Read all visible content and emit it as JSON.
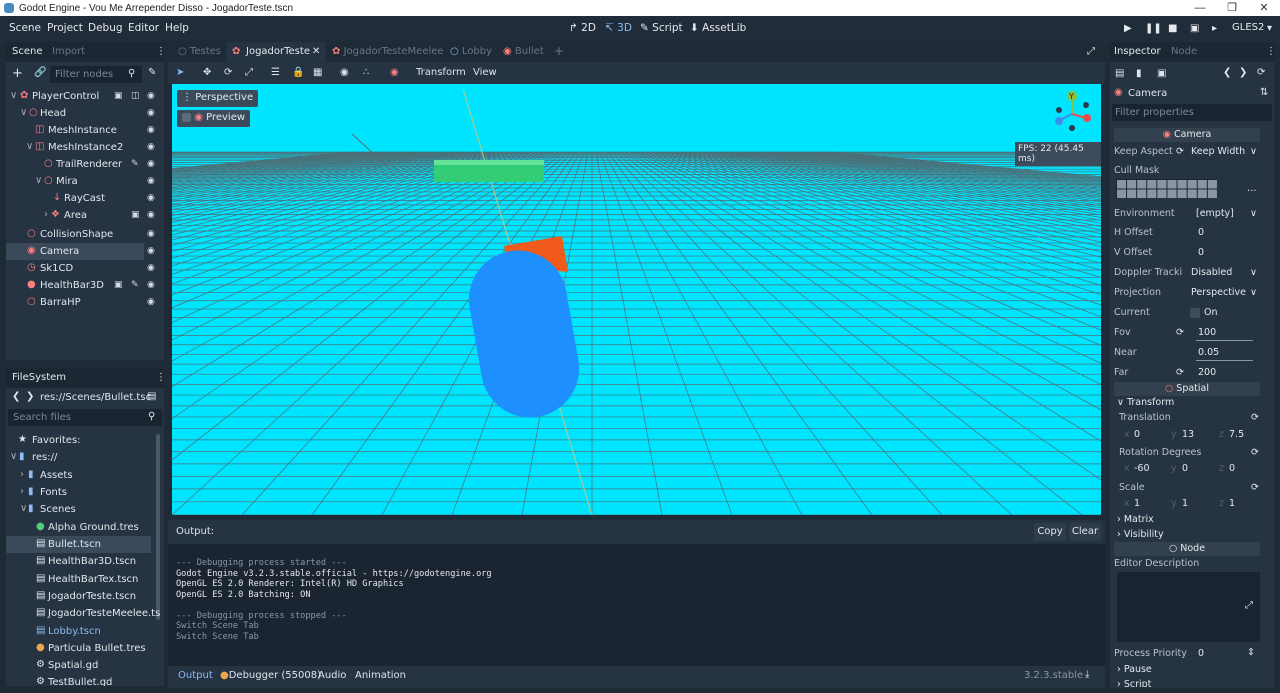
{
  "window": {
    "title": "Godot Engine - Vou Me Arrepender Disso - JogadorTeste.tscn"
  },
  "menu": [
    "Scene",
    "Project",
    "Debug",
    "Editor",
    "Help"
  ],
  "workspaces": [
    "2D",
    "3D",
    "Script",
    "AssetLib"
  ],
  "renderer": "GLES2",
  "scene_dock": {
    "tabs": [
      "Scene",
      "Import"
    ],
    "filter_placeholder": "Filter nodes",
    "nodes": [
      {
        "label": "PlayerControl",
        "icon": "kinematic-body-icon"
      },
      {
        "label": "Head",
        "icon": "spatial-icon"
      },
      {
        "label": "MeshInstance",
        "icon": "mesh-instance-icon"
      },
      {
        "label": "MeshInstance2",
        "icon": "mesh-instance-icon"
      },
      {
        "label": "TrailRenderer",
        "icon": "spatial-icon"
      },
      {
        "label": "Mira",
        "icon": "spatial-icon"
      },
      {
        "label": "RayCast",
        "icon": "raycast-icon"
      },
      {
        "label": "Area",
        "icon": "area-icon"
      },
      {
        "label": "CollisionShape",
        "icon": "spatial-icon"
      },
      {
        "label": "Camera",
        "icon": "camera-icon"
      },
      {
        "label": "Sk1CD",
        "icon": "timer-icon"
      },
      {
        "label": "HealthBar3D",
        "icon": "scene-instance-icon"
      },
      {
        "label": "BarraHP",
        "icon": "spatial-icon"
      }
    ]
  },
  "filesystem": {
    "title": "FileSystem",
    "path": "res://Scenes/Bullet.tsc",
    "search_placeholder": "Search files",
    "items": [
      {
        "label": "Favorites:",
        "icon": "star-icon"
      },
      {
        "label": "res://",
        "icon": "folder-icon"
      },
      {
        "label": "Assets",
        "icon": "folder-icon"
      },
      {
        "label": "Fonts",
        "icon": "folder-icon"
      },
      {
        "label": "Scenes",
        "icon": "folder-icon"
      },
      {
        "label": "Alpha Ground.tres",
        "icon": "resource-icon"
      },
      {
        "label": "Bullet.tscn",
        "icon": "scene-file-icon"
      },
      {
        "label": "HealthBar3D.tscn",
        "icon": "scene-file-icon"
      },
      {
        "label": "HealthBarTex.tscn",
        "icon": "scene-file-icon"
      },
      {
        "label": "JogadorTeste.tscn",
        "icon": "scene-file-icon"
      },
      {
        "label": "JogadorTesteMeelee.ts",
        "icon": "scene-file-icon"
      },
      {
        "label": "Lobby.tscn",
        "icon": "scene-file-icon"
      },
      {
        "label": "Particula Bullet.tres",
        "icon": "material-icon"
      },
      {
        "label": "Spatial.gd",
        "icon": "script-icon"
      },
      {
        "label": "TestBullet.gd",
        "icon": "script-icon"
      }
    ]
  },
  "scene_tabs": [
    "Testes",
    "JogadorTeste",
    "JogadorTesteMeelee",
    "Lobby",
    "Bullet"
  ],
  "viewport_toolbar": {
    "transform": "Transform",
    "view": "View"
  },
  "viewport": {
    "perspective": "Perspective",
    "preview": "Preview",
    "fps": "FPS: 22 (45.45 ms)",
    "gizmo_y": "Y"
  },
  "output": {
    "label": "Output:",
    "copy": "Copy",
    "clear": "Clear",
    "lines": [
      "--- Debugging process started ---",
      "Godot Engine v3.2.3.stable.official - https://godotengine.org",
      "OpenGL ES 2.0 Renderer: Intel(R) HD Graphics",
      "OpenGL ES 2.0 Batching: ON",
      "",
      "--- Debugging process stopped ---",
      "Switch Scene Tab",
      "Switch Scene Tab"
    ]
  },
  "bottom_tabs": [
    "Output",
    "Debugger (55008)",
    "Audio",
    "Animation"
  ],
  "version": "3.2.3.stable",
  "inspector": {
    "tabs": [
      "Inspector",
      "Node"
    ],
    "object": "Camera",
    "filter_placeholder": "Filter properties",
    "section": "Camera",
    "keep_aspect": {
      "label": "Keep Aspect",
      "value": "Keep Width"
    },
    "cull_mask": "Cull Mask",
    "environment": {
      "label": "Environment",
      "value": "[empty]"
    },
    "h_offset": {
      "label": "H Offset",
      "value": "0"
    },
    "v_offset": {
      "label": "V Offset",
      "value": "0"
    },
    "doppler": {
      "label": "Doppler Tracki",
      "value": "Disabled"
    },
    "projection": {
      "label": "Projection",
      "value": "Perspective"
    },
    "current": {
      "label": "Current",
      "value": "On"
    },
    "fov": {
      "label": "Fov",
      "value": "100"
    },
    "near": {
      "label": "Near",
      "value": "0.05"
    },
    "far": {
      "label": "Far",
      "value": "200"
    },
    "spatial": "Spatial",
    "transform": "Transform",
    "translation": {
      "label": "Translation",
      "x": "0",
      "y": "13",
      "z": "7.5"
    },
    "rotation": {
      "label": "Rotation Degrees",
      "x": "-60",
      "y": "0",
      "z": "0"
    },
    "scale": {
      "label": "Scale",
      "x": "1",
      "y": "1",
      "z": "1"
    },
    "matrix": "Matrix",
    "visibility": "Visibility",
    "node": "Node",
    "editor_description": "Editor Description",
    "process_priority": {
      "label": "Process Priority",
      "value": "0"
    },
    "pause": "Pause",
    "script": "Script"
  },
  "axis_letters": {
    "x": "x",
    "y": "y",
    "z": "z"
  },
  "colors": {
    "viewport_bg": "#00e5ff",
    "capsule": "#1e8fff",
    "accent": "#8cbcf0"
  }
}
